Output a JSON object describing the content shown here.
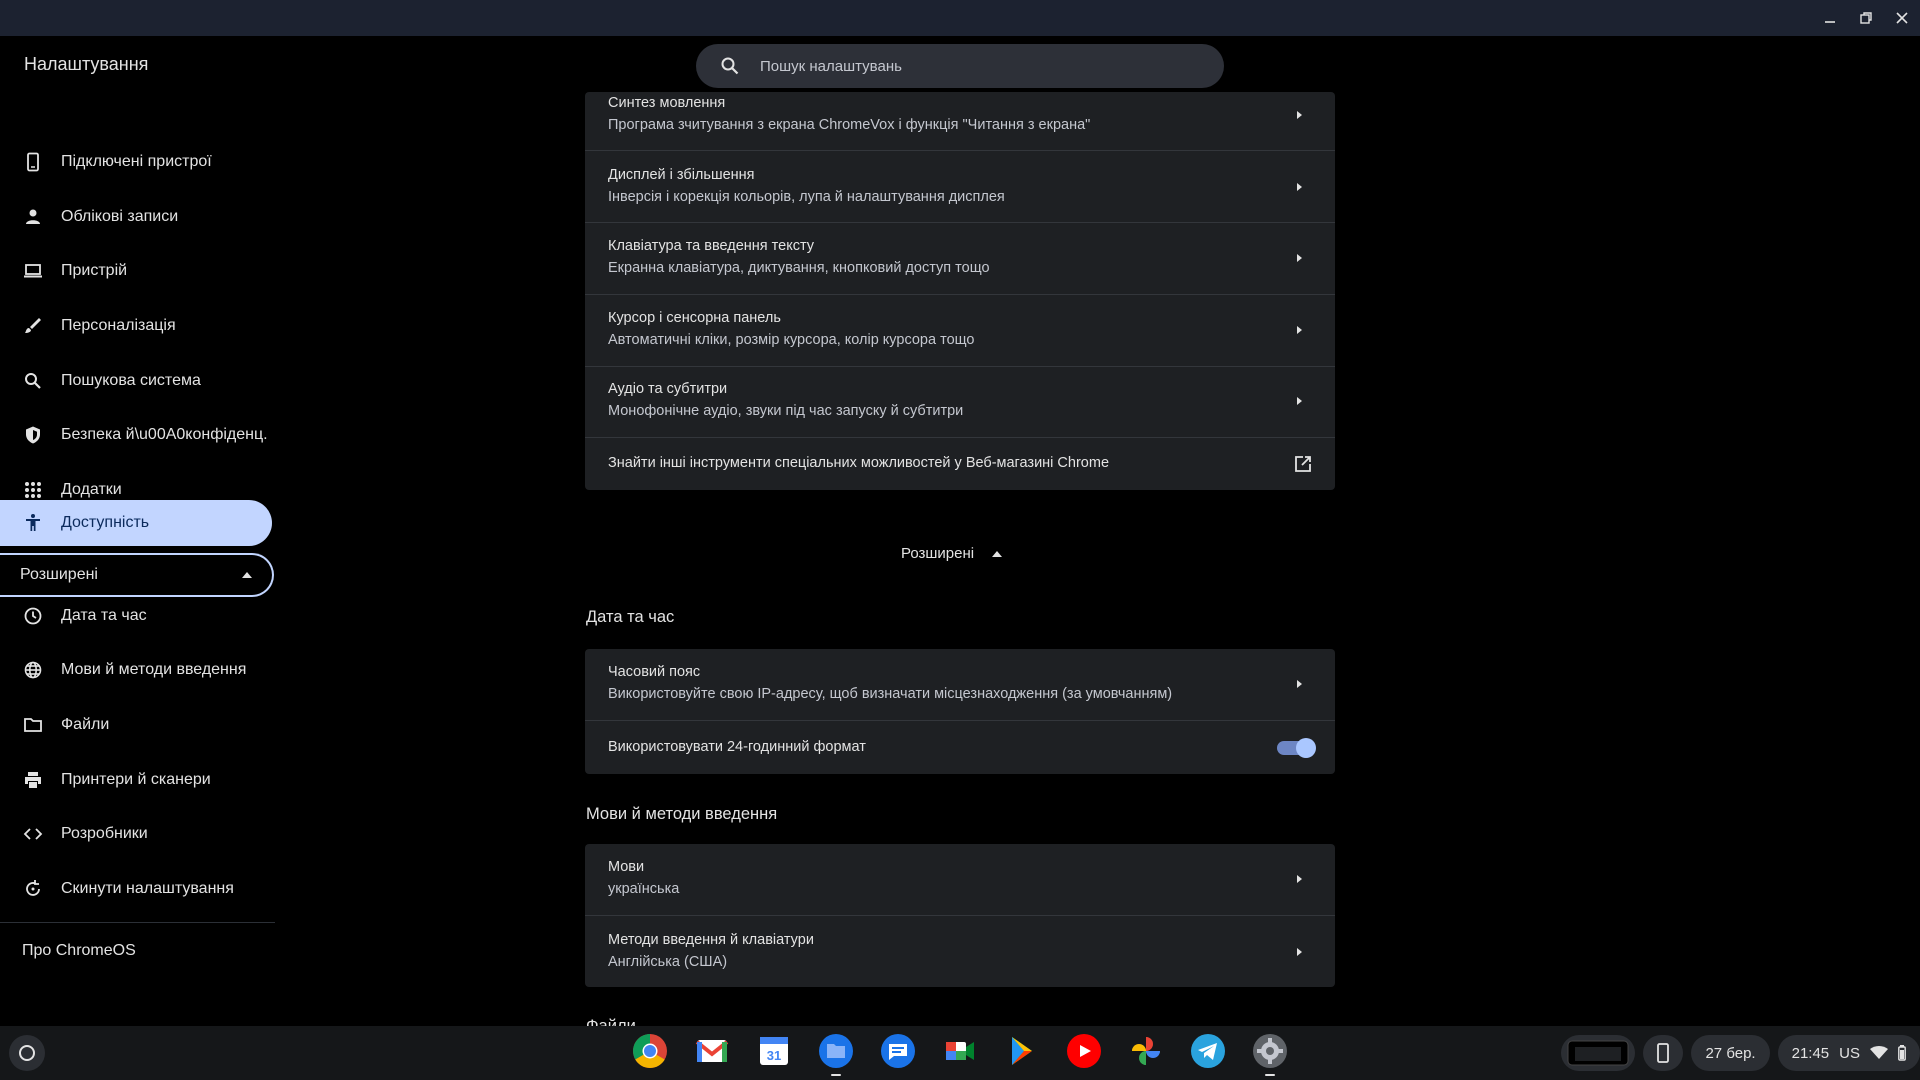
{
  "app_title": "Налаштування",
  "search": {
    "placeholder": "Пошук налаштувань"
  },
  "sidebar": {
    "items": [
      {
        "label": "Підключені пристрої",
        "icon": "phone-icon"
      },
      {
        "label": "Облікові записи",
        "icon": "person-icon"
      },
      {
        "label": "Пристрій",
        "icon": "laptop-icon"
      },
      {
        "label": "Персоналізація",
        "icon": "brush-icon"
      },
      {
        "label": "Пошукова система",
        "icon": "search-icon"
      },
      {
        "label": "Безпека й\\u00A0конфіденц.",
        "icon": "shield-icon"
      },
      {
        "label": "Додатки",
        "icon": "apps-grid-icon"
      },
      {
        "label": "Доступність",
        "icon": "accessibility-icon",
        "active": true
      }
    ],
    "advanced_label": "Розширені",
    "advanced_items": [
      {
        "label": "Дата та час",
        "icon": "clock-icon"
      },
      {
        "label": "Мови й методи введення",
        "icon": "globe-icon"
      },
      {
        "label": "Файли",
        "icon": "folder-icon"
      },
      {
        "label": "Принтери й сканери",
        "icon": "printer-icon"
      },
      {
        "label": "Розробники",
        "icon": "code-icon"
      },
      {
        "label": "Скинути налаштування",
        "icon": "reset-icon"
      }
    ],
    "about": "Про ChromeOS"
  },
  "accessibility_rows": [
    {
      "title": "Синтез мовлення",
      "subtitle": "Програма зчитування з екрана ChromeVox і функція \"Читання з екрана\""
    },
    {
      "title": "Дисплей і збільшення",
      "subtitle": "Інверсія і корекція кольорів, лупа й налаштування дисплея"
    },
    {
      "title": "Клавіатура та введення тексту",
      "subtitle": "Екранна клавіатура, диктування, кнопковий доступ тощо"
    },
    {
      "title": "Курсор і сенсорна панель",
      "subtitle": "Автоматичні кліки, розмір курсора, колір курсора тощо"
    },
    {
      "title": "Аудіо та субтитри",
      "subtitle": "Монофонічне аудіо, звуки під час запуску й субтитри"
    }
  ],
  "webstore_link": "Знайти інші інструменти спеціальних можливостей у Веб-магазині Chrome",
  "advanced_center_label": "Розширені",
  "datetime_section": {
    "title": "Дата та час",
    "timezone_title": "Часовий пояс",
    "timezone_sub": "Використовуйте свою IP-адресу, щоб визначати місцезнаходження (за умовчанням)",
    "format_24h": "Використовувати 24-годинний формат",
    "format_24h_on": true
  },
  "languages_section": {
    "title": "Мови й методи введення",
    "langs_title": "Мови",
    "langs_sub": "українська",
    "input_title": "Методи введення й клавіатури",
    "input_sub": "Англійська (США)"
  },
  "files_section_title": "Файли",
  "shelf": {
    "apps": [
      "chrome-icon",
      "gmail-icon",
      "calendar-icon",
      "files-icon",
      "messages-icon",
      "meet-icon",
      "play-store-icon",
      "youtube-icon",
      "photos-icon",
      "telegram-icon",
      "settings-icon"
    ],
    "calendar_day": "31",
    "date": "27 бер.",
    "time": "21:45",
    "keyboard_layout": "US"
  },
  "colors": {
    "accent": "#c2d5ff",
    "card": "#1e2023",
    "titlebar": "#1c2230"
  }
}
